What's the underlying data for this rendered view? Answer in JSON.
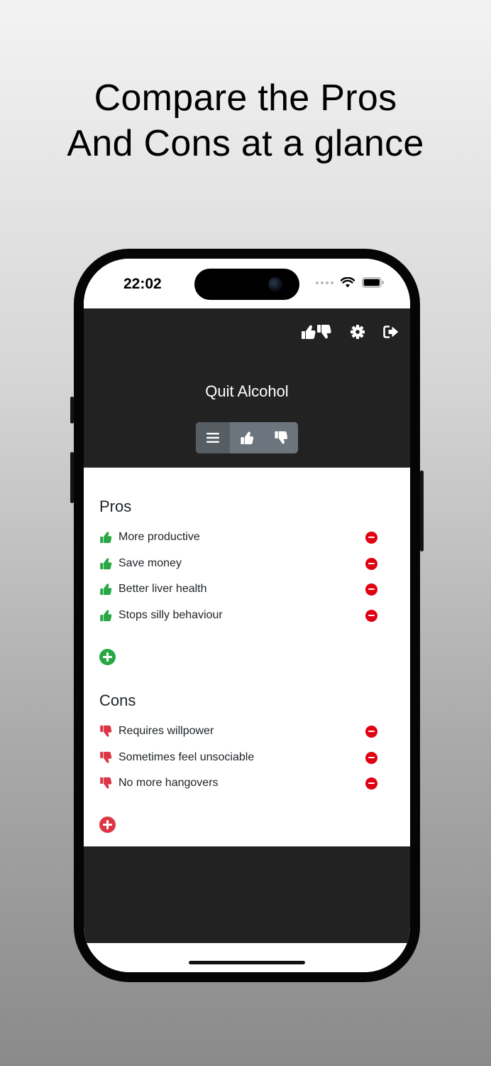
{
  "headline": {
    "line1": "Compare the Pros",
    "line2": "And Cons at a glance"
  },
  "status_bar": {
    "time": "22:02",
    "icons": [
      "signal-dots-icon",
      "wifi-icon",
      "battery-icon"
    ]
  },
  "header": {
    "icons": [
      "thumbs-up-down-icon",
      "gear-icon",
      "sign-out-icon"
    ],
    "title": "Quit Alcohol",
    "view_toggle": [
      {
        "icon": "list-icon",
        "active": true
      },
      {
        "icon": "thumbs-up-icon",
        "active": false
      },
      {
        "icon": "thumbs-down-icon",
        "active": false
      }
    ]
  },
  "pros": {
    "title": "Pros",
    "items": [
      {
        "label": "More productive"
      },
      {
        "label": "Save money"
      },
      {
        "label": "Better liver health"
      },
      {
        "label": "Stops silly behaviour"
      }
    ],
    "add_icon": "plus-circle-icon"
  },
  "cons": {
    "title": "Cons",
    "items": [
      {
        "label": "Requires willpower"
      },
      {
        "label": "Sometimes feel unsociable"
      },
      {
        "label": "No more hangovers"
      }
    ],
    "add_icon": "plus-circle-icon"
  },
  "colors": {
    "header_bg": "#222222",
    "pro_green": "#28a745",
    "con_red": "#dc3545",
    "remove_red": "#e00012",
    "toggle_bg": "#6c757d",
    "toggle_active": "#565e64"
  }
}
